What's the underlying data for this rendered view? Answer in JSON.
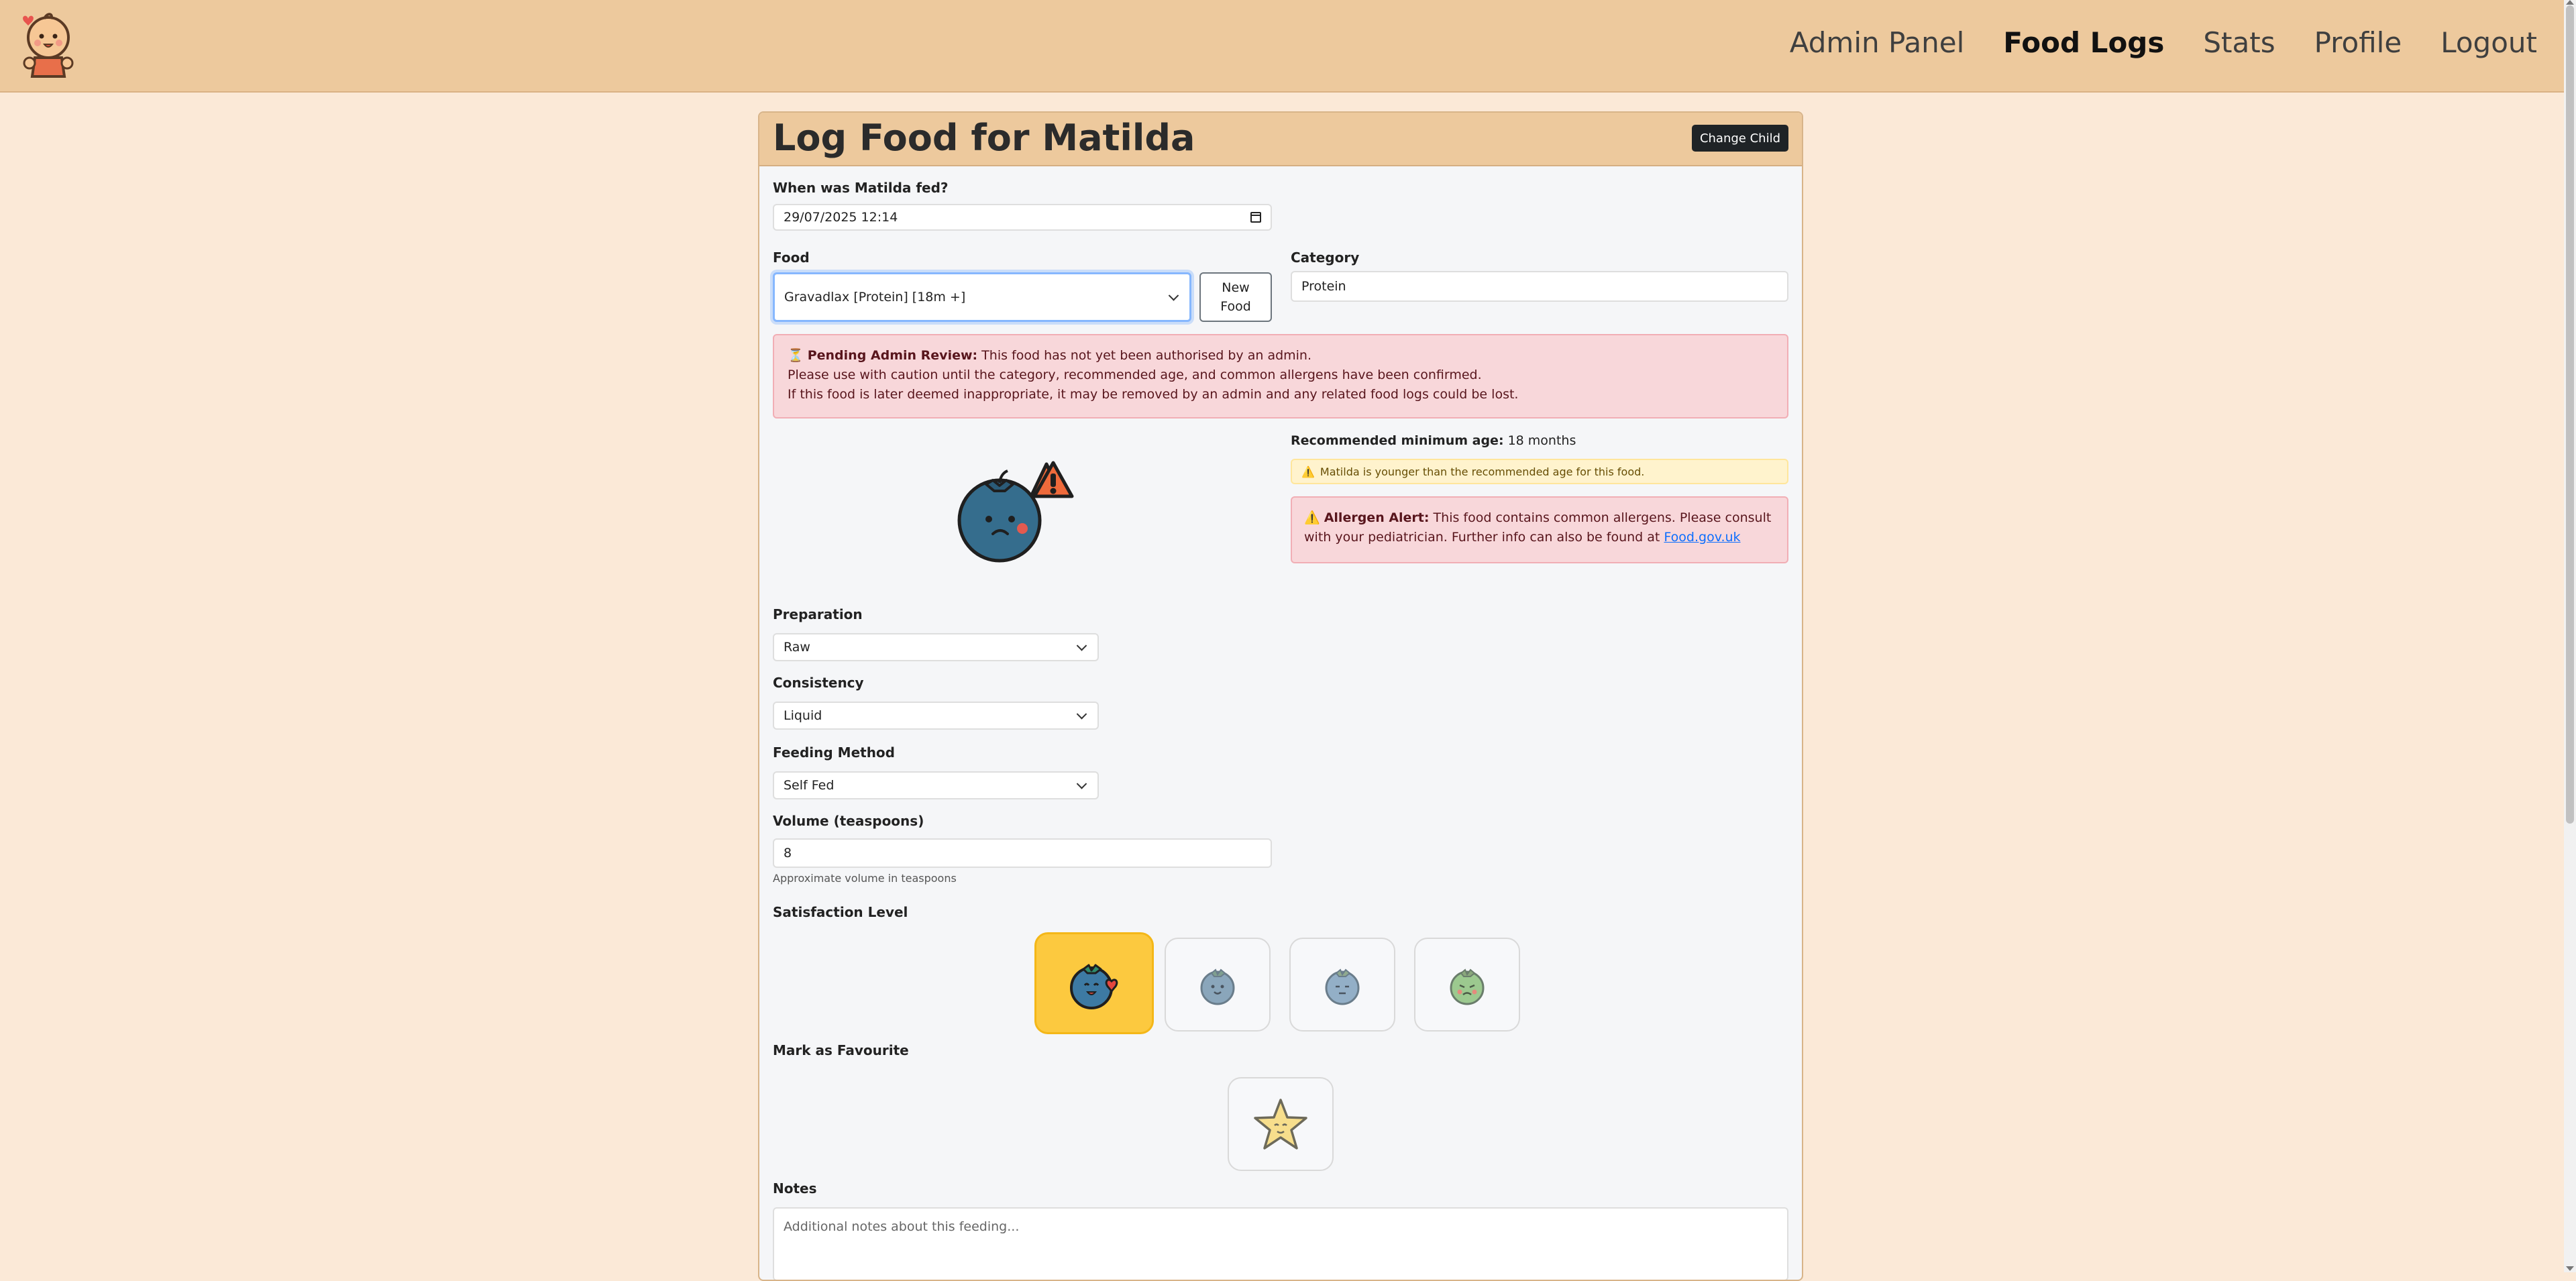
{
  "nav": {
    "items": [
      "Admin Panel",
      "Food Logs",
      "Stats",
      "Profile",
      "Logout"
    ],
    "active": "Food Logs"
  },
  "page": {
    "title_prefix": "Log Food for",
    "child_name": "Matilda",
    "change_child_label": "Change Child"
  },
  "form": {
    "when_label": "When was Matilda fed?",
    "when_value": "29/07/2025 12:14",
    "food_label": "Food",
    "food_value": "Gravadlax [Protein] [18m +]",
    "new_food_line1": "New",
    "new_food_line2": "Food",
    "category_label": "Category",
    "category_value": "Protein",
    "preparation_label": "Preparation",
    "preparation_value": "Raw",
    "consistency_label": "Consistency",
    "consistency_value": "Liquid",
    "feeding_label": "Feeding Method",
    "feeding_value": "Self Fed",
    "volume_label": "Volume (teaspoons)",
    "volume_value": "8",
    "volume_help": "Approximate volume in teaspoons",
    "satisfaction_label": "Satisfaction Level",
    "satisfaction_selected_index": 0,
    "favourite_label": "Mark as Favourite",
    "notes_label": "Notes",
    "notes_placeholder": "Additional notes about this feeding..."
  },
  "alerts": {
    "pending_icon": "⏳",
    "pending_title": "Pending Admin Review:",
    "pending_line1": " This food has not yet been authorised by an admin.",
    "pending_line2": "Please use with caution until the category, recommended age, and common allergens have been confirmed.",
    "pending_line3": "If this food is later deemed inappropriate, it may be removed by an admin and any related food logs could be lost.",
    "rec_age_label": "Recommended minimum age:",
    "rec_age_value": " 18 months",
    "warn_icon": "⚠️",
    "age_warning": "Matilda is younger than the recommended age for this food.",
    "allergen_title": "Allergen Alert:",
    "allergen_text": " This food contains common allergens. Please consult with your pediatrician. Further info can also be found at ",
    "allergen_link": "Food.gov.uk"
  },
  "colors": {
    "navbar": "#edc99d",
    "page_bg": "#fbe9d7",
    "selected_satisfaction": "#fcc93f",
    "danger_bg": "#f8d7da",
    "warning_bg": "#fff3cd"
  }
}
